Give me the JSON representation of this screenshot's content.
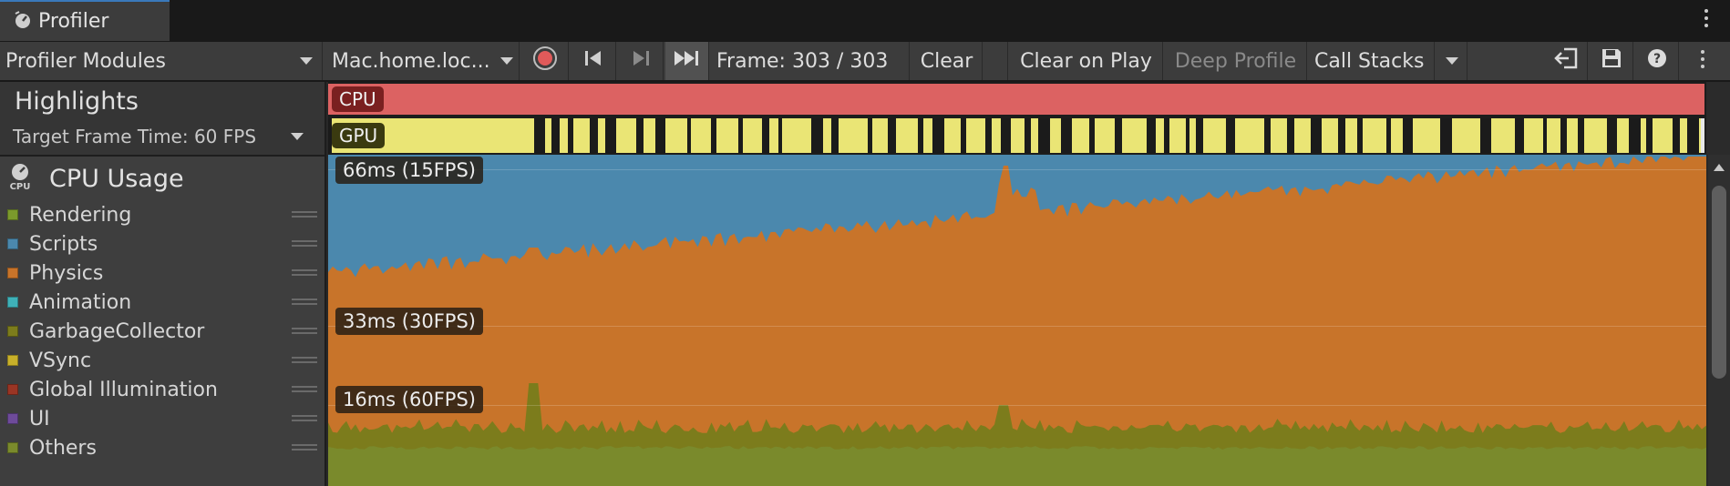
{
  "window": {
    "tab_title": "Profiler"
  },
  "toolbar": {
    "modules_dropdown": "Profiler Modules",
    "target_dropdown": "Mac.home.loc...",
    "frame_label": "Frame: 303 / 303",
    "clear": "Clear",
    "clear_on_play": "Clear on Play",
    "deep_profile": "Deep Profile",
    "call_stacks": "Call Stacks"
  },
  "highlights": {
    "title": "Highlights",
    "target_frame_time": "Target Frame Time: 60 FPS",
    "cpu_label": "CPU",
    "gpu_label": "GPU"
  },
  "module": {
    "icon_text": "CPU",
    "title": "CPU Usage",
    "legend": [
      {
        "label": "Rendering",
        "color": "#7b9a2c"
      },
      {
        "label": "Scripts",
        "color": "#4b88ad"
      },
      {
        "label": "Physics",
        "color": "#c8742a"
      },
      {
        "label": "Animation",
        "color": "#3fb1b8"
      },
      {
        "label": "GarbageCollector",
        "color": "#7c7c1c"
      },
      {
        "label": "VSync",
        "color": "#c8b02a"
      },
      {
        "label": "Global Illumination",
        "color": "#9a3524"
      },
      {
        "label": "UI",
        "color": "#6e4b9a"
      },
      {
        "label": "Others",
        "color": "#7a8a2c"
      }
    ]
  },
  "chart": {
    "ref_66": "66ms (15FPS)",
    "ref_33": "33ms (30FPS)",
    "ref_16": "16ms (60FPS)"
  },
  "chart_data": {
    "type": "area",
    "frames": [
      1,
      303
    ],
    "ylim_ms": [
      0,
      70
    ],
    "reference_lines_ms": [
      66,
      33,
      16
    ],
    "series": [
      {
        "name": "Others",
        "color": "#7a8a2c"
      },
      {
        "name": "GarbageCollector",
        "color": "#7c7c1c"
      },
      {
        "name": "Physics",
        "color": "#c8742a"
      },
      {
        "name": "Scripts",
        "color": "#4b88ad"
      }
    ]
  },
  "colors": {
    "cpu_highlight": "#dc6262",
    "gpu_highlight": "#eae575",
    "record_button": "#e05a5a"
  }
}
